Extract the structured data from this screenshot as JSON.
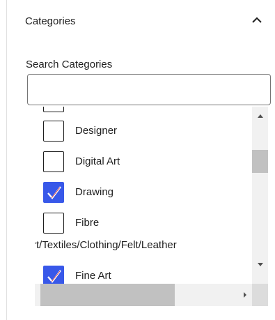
{
  "panel": {
    "title": "Categories"
  },
  "search": {
    "label": "Search Categories",
    "value": "",
    "placeholder": ""
  },
  "categories": [
    {
      "label": "Designer",
      "checked": false
    },
    {
      "label": "Digital Art",
      "checked": false
    },
    {
      "label": "Drawing",
      "checked": true
    },
    {
      "label_line1": "Fibre",
      "label_line2": "Art/Textiles/Clothing/Felt/Leather",
      "checked": false
    },
    {
      "label": "Fine Art",
      "checked": true
    }
  ],
  "colors": {
    "checkbox_checked": "#3858e9",
    "checkmark": "#ffffff",
    "checkmark_accent": "#d63638",
    "border": "#1e1e1e",
    "scrollbar_track": "#f1f1f1",
    "scrollbar_thumb": "#c1c1c1"
  },
  "icons": {
    "collapse": "chevron-up-icon",
    "scroll_up": "triangle-up-icon",
    "scroll_down": "triangle-down-icon",
    "scroll_left": "triangle-left-icon",
    "scroll_right": "triangle-right-icon",
    "check": "checkmark-icon"
  }
}
